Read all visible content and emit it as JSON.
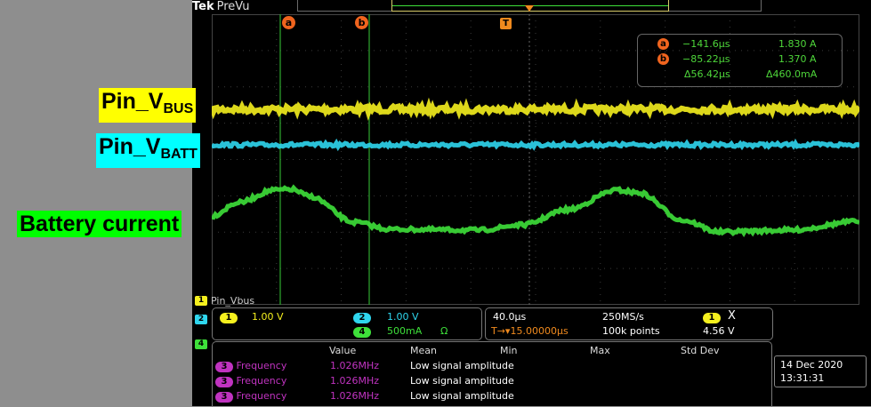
{
  "scope": {
    "brand": "Tek",
    "mode": "PreVu",
    "colors": {
      "ch1": "#f5f01e",
      "ch2": "#2fd6ee",
      "ch4": "#3ee03a",
      "cursor": "#f0641e",
      "math": "#c033c0"
    }
  },
  "annotations": {
    "vbus": {
      "main": "Pin_V",
      "sub": "BUS",
      "bg": "#ffff00"
    },
    "vbatt": {
      "main": "Pin_V",
      "sub": "BATT",
      "bg": "#00ffff"
    },
    "current": {
      "text": "Battery current",
      "bg": "#00ff00"
    }
  },
  "cursors": {
    "a_marker": "a",
    "b_marker": "b",
    "trigger_marker": "T",
    "a_time": "−141.6µs",
    "a_value": "1.830 A",
    "b_time": "−85.22µs",
    "b_value": "1.370 A",
    "delta_time": "Δ56.42µs",
    "delta_value": "Δ460.0mA"
  },
  "channel_labels": {
    "ch1_name": "Pin_Vbus",
    "b1": "1",
    "b2": "2",
    "b4": "4"
  },
  "channels": {
    "ch1": {
      "num": "1",
      "scale": "1.00 V"
    },
    "ch2": {
      "num": "2",
      "scale": "1.00 V"
    },
    "ch4": {
      "num": "4",
      "scale": "500mA",
      "term": "Ω"
    }
  },
  "horizontal": {
    "timebase": "40.0µs",
    "sample_rate": "250MS/s",
    "trig_pos": "T→▾15.00000µs",
    "record": "100k points",
    "trig_src": "1",
    "trig_edge": "X",
    "trig_level": "4.56 V"
  },
  "stats": {
    "headers": [
      "Value",
      "Mean",
      "Min",
      "Max",
      "Std Dev"
    ],
    "rows": [
      {
        "src": "3",
        "name": "Frequency",
        "value": "1.026MHz",
        "mean": "Low signal amplitude"
      },
      {
        "src": "3",
        "name": "Frequency",
        "value": "1.026MHz",
        "mean": "Low signal amplitude"
      },
      {
        "src": "3",
        "name": "Frequency",
        "value": "1.026MHz",
        "mean": "Low signal amplitude"
      }
    ]
  },
  "datetime": {
    "date": "14 Dec  2020",
    "time": "13:31:31"
  }
}
